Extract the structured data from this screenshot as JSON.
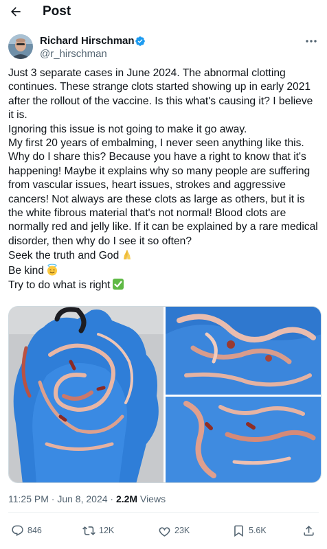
{
  "header": {
    "title": "Post",
    "back_icon": "arrow-left-icon"
  },
  "author": {
    "name": "Richard Hirschman",
    "handle": "@r_hirschman",
    "verified": true,
    "verified_color": "#1d9bf0"
  },
  "post": {
    "lines": [
      "Just 3 separate cases in June 2024. The abnormal clotting",
      "continues. These strange clots started showing up in early 2021",
      "after the rollout of the vaccine. Is this what's causing it? I believe",
      "it is.",
      "Ignoring this issue is not going to make it go away.",
      "My first 20 years of embalming, I never seen anything like this.",
      "Why do I share this? Because you have a right to know that it's",
      "happening! Maybe it explains why so many people are suffering",
      "from vascular issues, heart issues, strokes and aggressive",
      "cancers! Not always are these clots as large as others, but it is",
      "the white fibrous material that's not normal! Blood clots are",
      "normally red and jelly like. If it can be explained by a rare medical",
      "disorder, then why do I see it so often?",
      "Seek the truth and God",
      "Be kind",
      "Try to do what is right"
    ],
    "emojis": {
      "line_14": "folded-hands-emoji",
      "line_15": "smiling-face-with-halo-emoji",
      "line_16": "check-mark-button-emoji"
    }
  },
  "media": {
    "count": 3,
    "images": [
      "blue-gloved-hand-with-clots-image",
      "clots-on-glove-top-image",
      "clots-on-glove-bottom-image"
    ]
  },
  "meta": {
    "time": "11:25 PM",
    "date": "Jun 8, 2024",
    "separator": "·",
    "views_count": "2.2M",
    "views_label": "Views"
  },
  "actions": {
    "replies": "846",
    "reposts": "12K",
    "likes": "23K",
    "bookmarks": "5.6K"
  },
  "colors": {
    "text": "#0f1419",
    "secondary": "#536471",
    "accent": "#1d9bf0",
    "divider": "#eff3f4"
  }
}
